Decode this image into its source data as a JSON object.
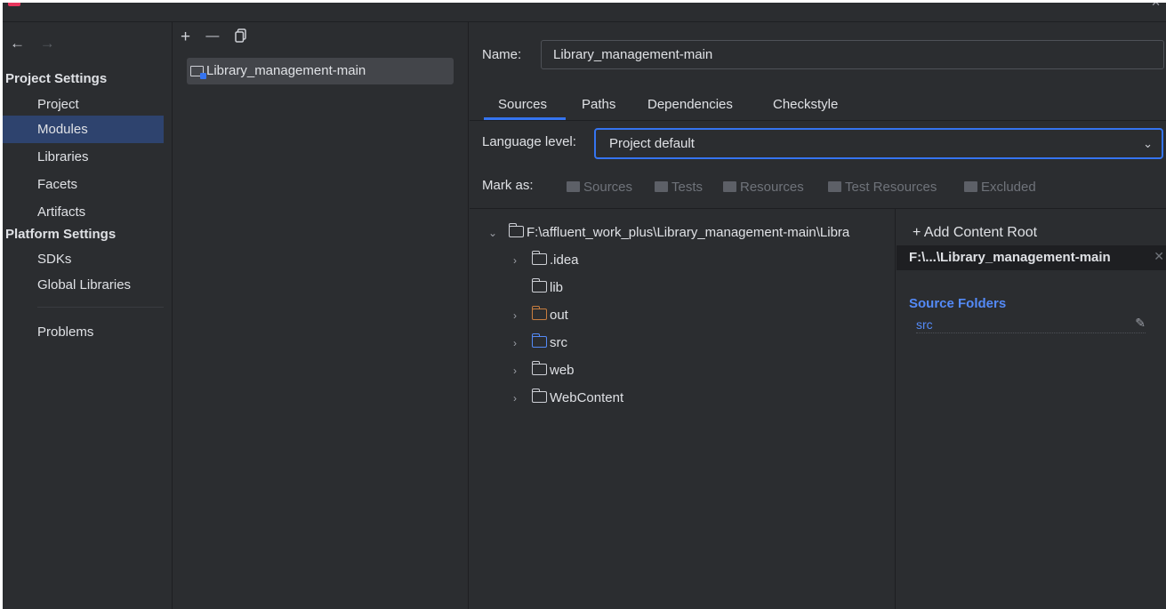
{
  "titlebar": {
    "close_icon": "close-icon"
  },
  "nav": {
    "back_icon": "←",
    "forward_icon": "→"
  },
  "sidebar": {
    "project_settings_header": "Project Settings",
    "platform_settings_header": "Platform Settings",
    "items": [
      {
        "label": "Project"
      },
      {
        "label": "Modules",
        "selected": true
      },
      {
        "label": "Libraries"
      },
      {
        "label": "Facets"
      },
      {
        "label": "Artifacts"
      },
      {
        "label": "SDKs"
      },
      {
        "label": "Global Libraries"
      },
      {
        "label": "Problems"
      }
    ]
  },
  "modules_toolbar": {
    "add_icon": "+",
    "remove_icon": "—",
    "copy_icon": "copy-icon"
  },
  "modules": {
    "items": [
      {
        "label": "Library_management-main"
      }
    ]
  },
  "details": {
    "name_label": "Name:",
    "name_value": "Library_management-main",
    "tabs": [
      {
        "label": "Sources",
        "active": true
      },
      {
        "label": "Paths"
      },
      {
        "label": "Dependencies"
      },
      {
        "label": "Checkstyle"
      }
    ],
    "language_level_label": "Language level:",
    "language_level_value": "Project default",
    "mark_as_label": "Mark as:",
    "mark_as_buttons": [
      "Sources",
      "Tests",
      "Resources",
      "Test Resources",
      "Excluded"
    ]
  },
  "tree": {
    "root": "F:\\affluent_work_plus\\Library_management-main\\Libra",
    "children": [
      {
        "label": ".idea",
        "expandable": true,
        "color": "default"
      },
      {
        "label": "lib",
        "expandable": false,
        "color": "default"
      },
      {
        "label": "out",
        "expandable": true,
        "color": "#c77d3f"
      },
      {
        "label": "src",
        "expandable": true,
        "color": "#548af7"
      },
      {
        "label": "web",
        "expandable": true,
        "color": "default"
      },
      {
        "label": "WebContent",
        "expandable": true,
        "color": "default"
      }
    ]
  },
  "content_roots": {
    "add_label": "+ Add Content Root",
    "root_path": "F:\\...\\Library_management-main",
    "source_folders_header": "Source Folders",
    "source_folders": [
      "src"
    ]
  },
  "colors": {
    "accent": "#3574f0",
    "selection": "#2e436e",
    "background": "#2b2d30",
    "source_blue": "#548af7",
    "excluded_orange": "#c77d3f"
  }
}
